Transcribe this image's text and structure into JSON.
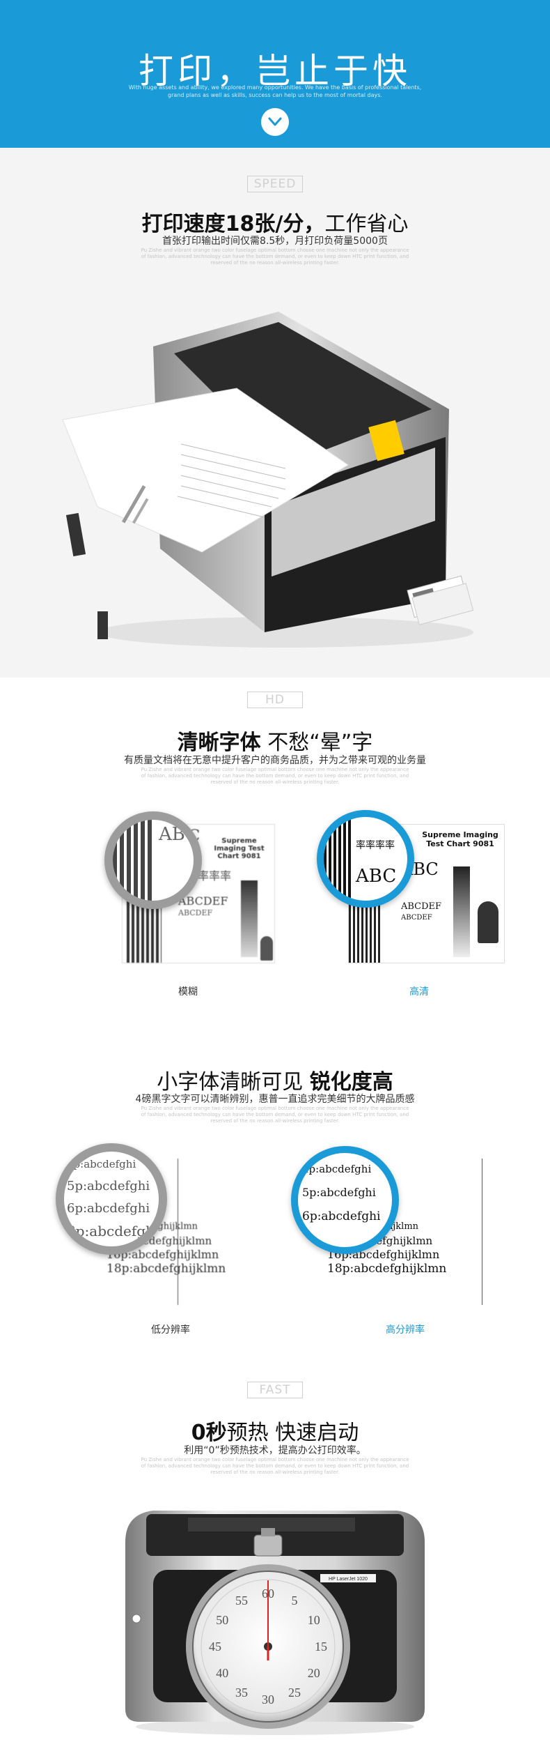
{
  "hero": {
    "title": "打印，岂止于快",
    "subtitle": "With huge assets and ability, we explored many opportunities. We have the basis of professional talents, grand plans as well as skills, success can help us to the most of mortal days."
  },
  "speed": {
    "tag": "SPEED",
    "title_bold": "打印速度18张/分，",
    "title_rest": "工作省心",
    "subtitle": "首张打印输出时间仅需8.5秒，月打印负荷量5000页",
    "fine": "Pu Zishe and vibrant orange two color fuselage optimal bottom choose one machine not only the appearance of fashion, advanced technology can have the bottom demand, or even to keep down HTC print function, and reserved of the no reason all-wireless printing faster."
  },
  "hd": {
    "tag": "HD",
    "title_bold": "清晰字体",
    "title_rest": " 不愁“晕”字",
    "subtitle": "有质量文档将在无意中提升客户的商务品质，并为之带来可观的业务量",
    "fine": "Pu Zishe and vibrant orange two color fuselage optimal bottom choose one machine not only the appearance of fashion, advanced technology can have the bottom demand, or even to keep down HTC print function, and reserved of the no reason all-wireless printing faster.",
    "left_caption": "模糊",
    "right_caption": "高清",
    "chart_title": "Supreme Imaging Test Chart 9081",
    "sample_big": "ABC",
    "sample_mid": "ABCDEF",
    "sample_small": "ABCDEF",
    "sample_cjk": "率率率率"
  },
  "small": {
    "title_rest": "小字体清晰可见 ",
    "title_bold": "锐化度高",
    "subtitle": "4磅黑字文字可以清晰辨别，惠普一直追求完美细节的大牌品质感",
    "fine": "Pu Zishe and vibrant orange two color fuselage optimal bottom choose one machine not only the appearance of fashion, advanced technology can have the bottom demand, or even to keep down HTC print function, and reserved of the no reason all-wireless printing faster.",
    "left_caption": "低分辨率",
    "right_caption": "高分辨率",
    "lines": [
      "4p:abcdefghi",
      "5p:abcdefghi",
      "6p:abcdefghi",
      "8p:abcdefghijklmn",
      "10p:abcdefghijklmn",
      "12p:abcdefghijklmn",
      "14p:abcdefghijklmn",
      "16p:abcdefghijklmn",
      "18p:abcdefghijklmn"
    ]
  },
  "fast": {
    "tag": "FAST",
    "title_bold": "0秒",
    "title_rest": "预热 快速启动",
    "subtitle": "利用“0”秒预热技术，提高办公打印效率。",
    "fine": "Pu Zishe and vibrant orange two color fuselage optimal bottom choose one machine not only the appearance of fashion, advanced technology can have the bottom demand, or even to keep down HTC print function, and reserved of the no reason all-wireless printing faster.",
    "printer_label": "HP LaserJet 1020",
    "dial_numbers": [
      "60",
      "5",
      "10",
      "15",
      "20",
      "25",
      "30",
      "35",
      "40",
      "45",
      "50",
      "55"
    ]
  },
  "colors": {
    "accent": "#1a9ad7",
    "gray_ring": "#9c9c9c"
  }
}
